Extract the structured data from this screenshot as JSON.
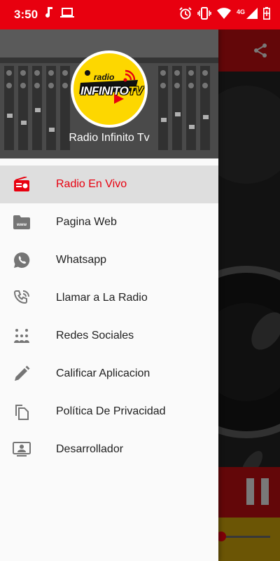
{
  "status_bar": {
    "time": "3:50",
    "network_label": "4G"
  },
  "drawer": {
    "header": {
      "logo_small_text": "radio",
      "logo_big_text": "INFINITO",
      "logo_big_suffix": "TV",
      "title": "Radio Infinito Tv"
    },
    "items": [
      {
        "label": "Radio En Vivo",
        "icon": "radio-icon",
        "active": true
      },
      {
        "label": "Pagina Web",
        "icon": "www-folder-icon",
        "active": false
      },
      {
        "label": "Whatsapp",
        "icon": "whatsapp-icon",
        "active": false
      },
      {
        "label": "Llamar a La Radio",
        "icon": "phone-call-icon",
        "active": false
      },
      {
        "label": "Redes Sociales",
        "icon": "social-dots-icon",
        "active": false
      },
      {
        "label": "Calificar Aplicacion",
        "icon": "pencil-icon",
        "active": false
      },
      {
        "label": "Política De Privacidad",
        "icon": "copy-documents-icon",
        "active": false
      },
      {
        "label": "Desarrollador",
        "icon": "developer-screen-icon",
        "active": false
      }
    ]
  },
  "colors": {
    "status_bar": "#e8000f",
    "accent": "#e8000f",
    "active_item_bg": "#dedede",
    "logo_yellow": "#fdd700"
  }
}
